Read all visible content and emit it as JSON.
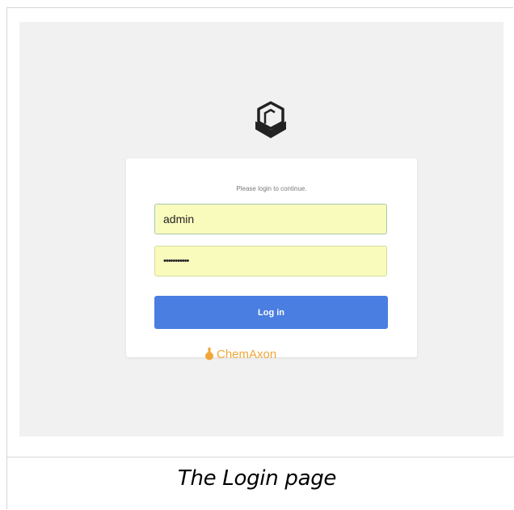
{
  "login": {
    "prompt": "Please login to continue.",
    "username_value": "admin",
    "password_value": "•••••••••••",
    "login_button": "Log in"
  },
  "brand": {
    "name": "ChemAxon",
    "logo_icon": "cube-logo-icon",
    "flask_icon": "flask-icon",
    "color": "#f1a638"
  },
  "colors": {
    "primary_button": "#4a7ee0",
    "autofill_field": "#f9fbbd",
    "background": "#f1f1f1"
  },
  "caption": "The Login page"
}
